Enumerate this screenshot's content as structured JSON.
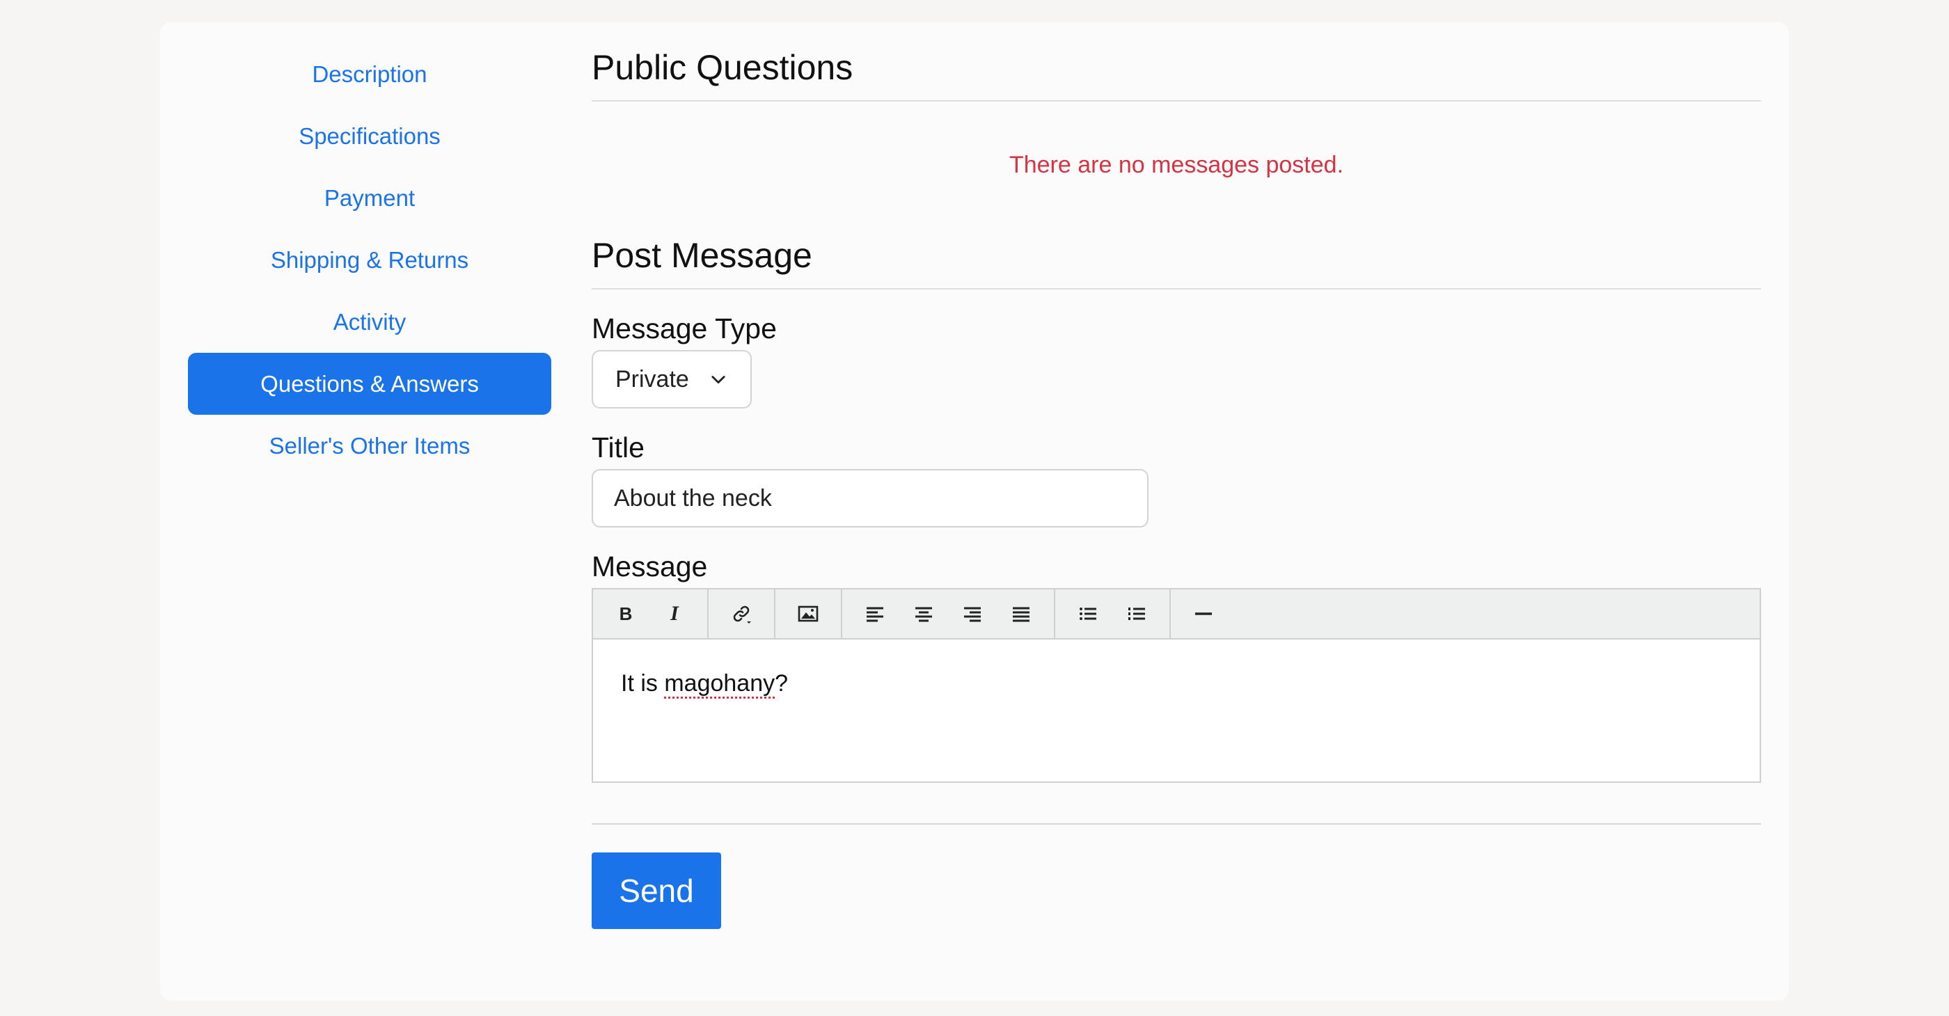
{
  "sidebar": {
    "items": [
      {
        "label": "Description"
      },
      {
        "label": "Specifications"
      },
      {
        "label": "Payment"
      },
      {
        "label": "Shipping & Returns"
      },
      {
        "label": "Activity"
      },
      {
        "label": "Questions & Answers",
        "active": true
      },
      {
        "label": "Seller's Other Items"
      }
    ]
  },
  "public_questions": {
    "title": "Public Questions",
    "empty_message": "There are no messages posted."
  },
  "post_message": {
    "title": "Post Message",
    "message_type": {
      "label": "Message Type",
      "selected": "Private"
    },
    "title_field": {
      "label": "Title",
      "value": "About the neck"
    },
    "message": {
      "label": "Message",
      "toolbar": {
        "bold": "B",
        "italic": "I",
        "icons": [
          "link-icon",
          "image-icon",
          "align-left-icon",
          "align-center-icon",
          "align-right-icon",
          "align-justify-icon",
          "bullet-list-icon",
          "numbered-list-icon",
          "horizontal-rule-icon"
        ]
      },
      "body_prefix": "It is ",
      "body_misspelled": "magohany",
      "body_suffix": "?"
    },
    "send_label": "Send"
  },
  "colors": {
    "accent": "#1a73e8",
    "error": "#d63342",
    "background": "#f6f5f4"
  }
}
